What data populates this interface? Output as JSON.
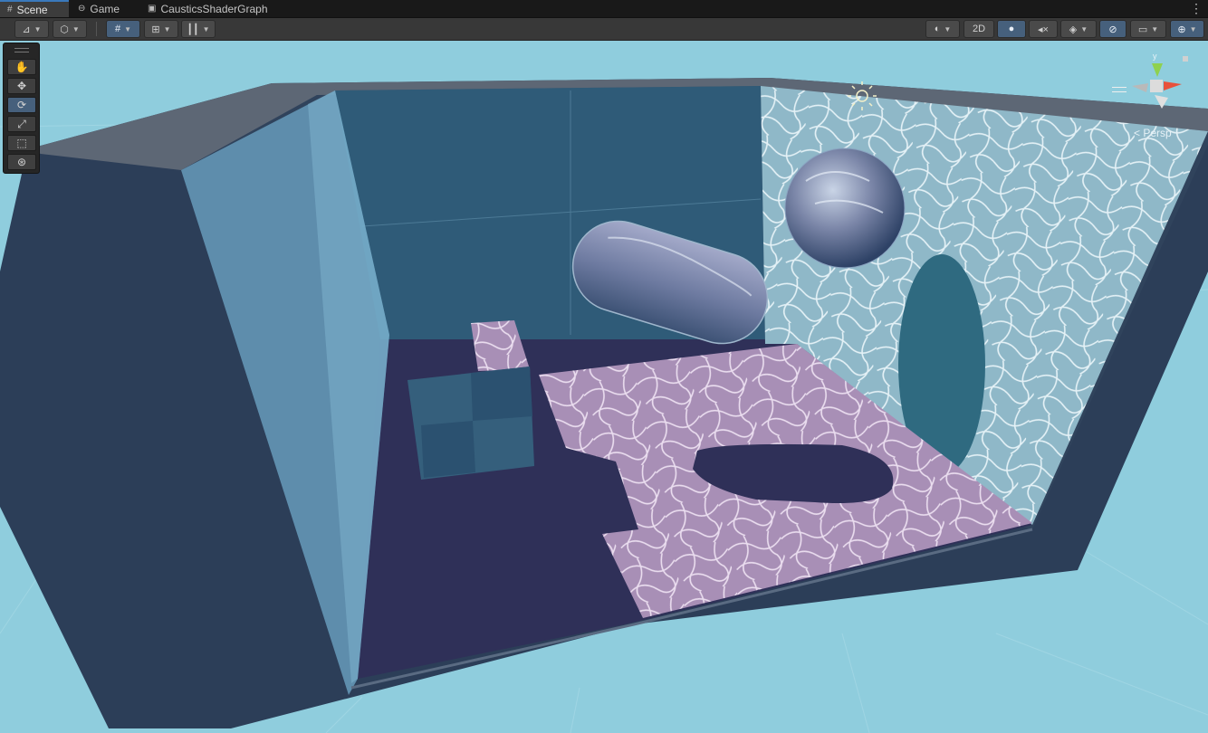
{
  "tabs": [
    {
      "label": "Scene",
      "icon": "grid-icon",
      "active": true
    },
    {
      "label": "Game",
      "icon": "gamepad-icon",
      "active": false
    },
    {
      "label": "CausticsShaderGraph",
      "icon": "shader-graph-icon",
      "active": false
    }
  ],
  "toolbar": {
    "left": [
      "draw-mode-icon",
      "shading-cube-icon",
      "grid-snap-icon",
      "increment-snap-icon",
      "ruler-icon"
    ],
    "right": [
      "render-mode-sphere-icon",
      "lighting-bulb-icon",
      "audio-mute-icon",
      "effects-layers-icon",
      "visibility-eye-icon",
      "camera-icon",
      "gizmos-icon"
    ],
    "two_d_label": "2D"
  },
  "tools": [
    "hand-tool-icon",
    "move-tool-icon",
    "rotate-tool-icon",
    "scale-tool-icon",
    "rect-tool-icon",
    "transform-tool-icon"
  ],
  "active_tool": "rotate-tool-icon",
  "scene": {
    "projection_label": "Persp",
    "gizmo_axes": {
      "y": "y",
      "x": "x",
      "z": "z"
    },
    "colors": {
      "sky": "#8fcddd",
      "walls": "#2c3e58",
      "glass": "#6fa8c8",
      "floor": "#2f3058",
      "caustics": "#b9a6c8"
    }
  }
}
